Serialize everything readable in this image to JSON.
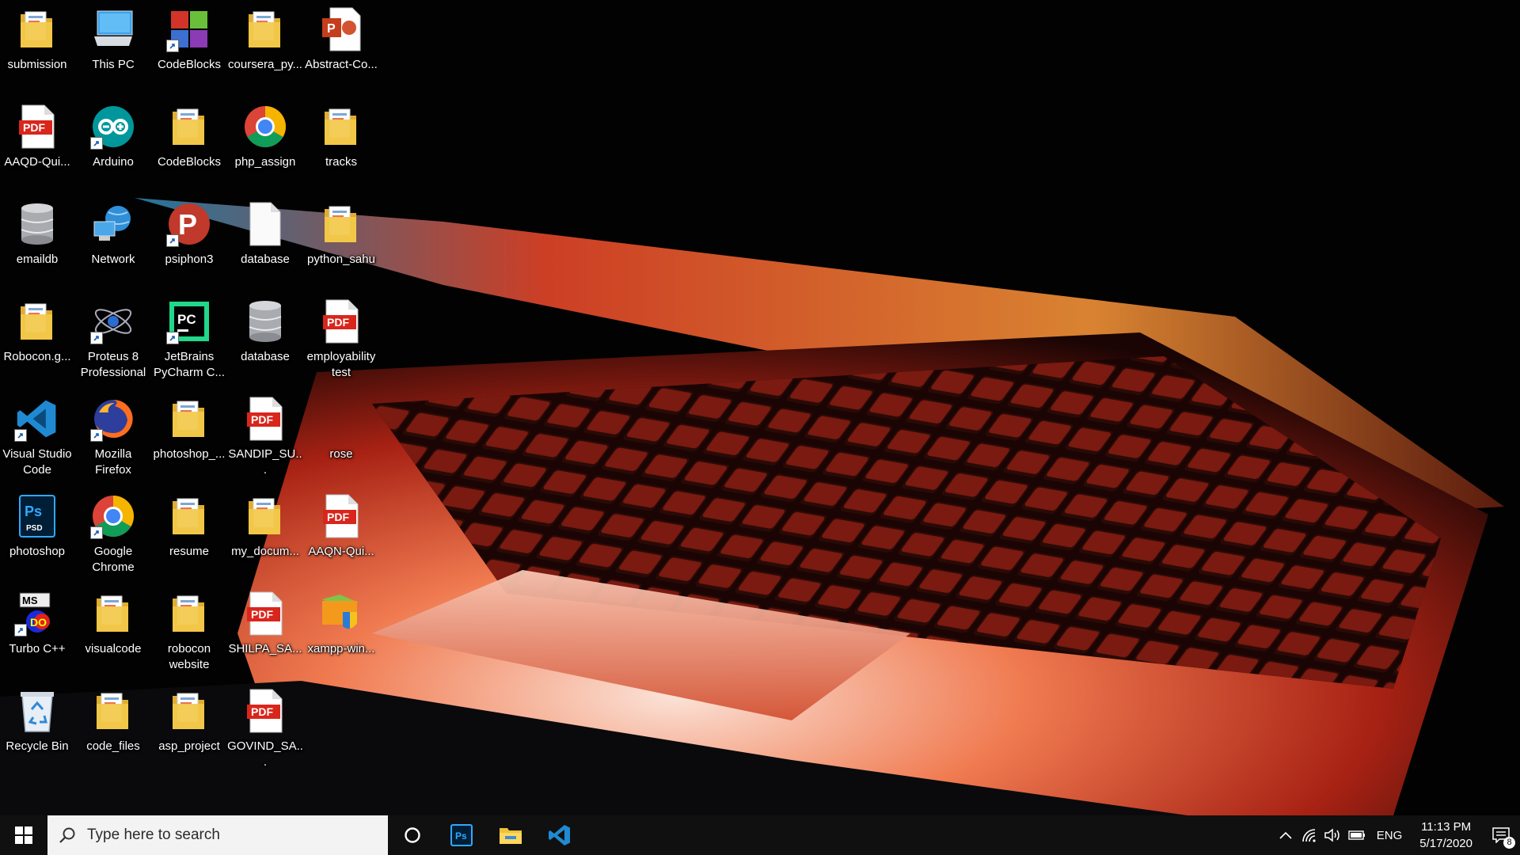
{
  "desktop": {
    "icons": [
      {
        "label": "submission",
        "icon": "folder-icon"
      },
      {
        "label": "This PC",
        "icon": "this-pc-icon"
      },
      {
        "label": "CodeBlocks",
        "icon": "codeblocks-icon"
      },
      {
        "label": "coursera_py...",
        "icon": "folder-icon"
      },
      {
        "label": "Abstract-Co...",
        "icon": "powerpoint-icon"
      },
      {
        "label": "AAQD-Qui...",
        "icon": "pdf-icon"
      },
      {
        "label": "Arduino",
        "icon": "arduino-icon"
      },
      {
        "label": "CodeBlocks",
        "icon": "folder-icon"
      },
      {
        "label": "php_assign",
        "icon": "chrome-icon"
      },
      {
        "label": "tracks",
        "icon": "folder-icon"
      },
      {
        "label": "emaildb",
        "icon": "database-icon"
      },
      {
        "label": "Network",
        "icon": "network-icon"
      },
      {
        "label": "psiphon3",
        "icon": "psiphon-icon"
      },
      {
        "label": "database",
        "icon": "blank-file-icon"
      },
      {
        "label": "python_sahu",
        "icon": "folder-icon"
      },
      {
        "label": "Robocon.g...",
        "icon": "folder-icon"
      },
      {
        "label": "Proteus 8 Professional",
        "icon": "proteus-icon"
      },
      {
        "label": "JetBrains PyCharm C...",
        "icon": "pycharm-icon"
      },
      {
        "label": "database",
        "icon": "database-icon"
      },
      {
        "label": "employability test",
        "icon": "pdf-icon"
      },
      {
        "label": "Visual Studio Code",
        "icon": "vscode-icon"
      },
      {
        "label": "Mozilla Firefox",
        "icon": "firefox-icon"
      },
      {
        "label": "photoshop_...",
        "icon": "folder-icon"
      },
      {
        "label": "SANDIP_SU...",
        "icon": "pdf-icon"
      },
      {
        "label": "rose",
        "icon": "image-file-icon"
      },
      {
        "label": "photoshop",
        "icon": "psd-file-icon"
      },
      {
        "label": "Google Chrome",
        "icon": "chrome-icon"
      },
      {
        "label": "resume",
        "icon": "folder-icon"
      },
      {
        "label": "my_docum...",
        "icon": "folder-icon"
      },
      {
        "label": "AAQN-Qui...",
        "icon": "pdf-icon"
      },
      {
        "label": "Turbo C++",
        "icon": "turbo-cpp-icon"
      },
      {
        "label": "visualcode",
        "icon": "folder-icon"
      },
      {
        "label": "robocon website",
        "icon": "folder-icon"
      },
      {
        "label": "SHILPA_SA...",
        "icon": "pdf-icon"
      },
      {
        "label": "xampp-win...",
        "icon": "xampp-installer-icon"
      },
      {
        "label": "Recycle Bin",
        "icon": "recycle-bin-icon"
      },
      {
        "label": "code_files",
        "icon": "folder-icon"
      },
      {
        "label": "asp_project",
        "icon": "folder-icon"
      },
      {
        "label": "GOVIND_SA...",
        "icon": "pdf-icon"
      }
    ]
  },
  "taskbar": {
    "search_placeholder": "Type here to search",
    "pinned": [
      "photoshop-icon",
      "file-explorer-icon",
      "vscode-icon"
    ],
    "tray": {
      "language": "ENG",
      "time": "11:13 PM",
      "date": "5/17/2020",
      "notification_count": "8"
    }
  },
  "colors": {
    "taskbar_bg": "#101010",
    "search_bg": "#f3f3f3",
    "pdf_red": "#d9261c",
    "folder_yellow": "#f3c94a"
  }
}
